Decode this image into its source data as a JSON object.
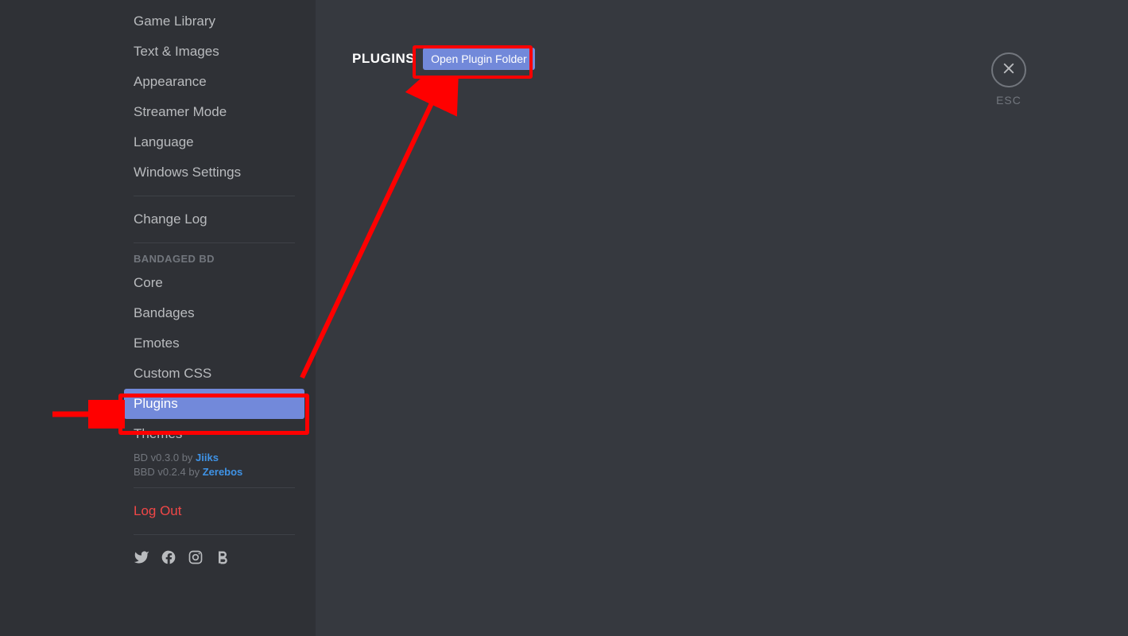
{
  "sidebar": {
    "items_top": [
      "Game Library",
      "Text & Images",
      "Appearance",
      "Streamer Mode",
      "Language",
      "Windows Settings"
    ],
    "change_log": "Change Log",
    "bbd_header": "BANDAGED BD",
    "bbd_items": [
      "Core",
      "Bandages",
      "Emotes",
      "Custom CSS",
      "Plugins",
      "Themes"
    ],
    "selected_index": 4,
    "version1_pre": "BD v0.3.0 by ",
    "version1_author": "Jiiks",
    "version2_pre": "BBD v0.2.4 by ",
    "version2_author": "Zerebos",
    "logout": "Log Out"
  },
  "content": {
    "title": "PLUGINS",
    "open_folder": "Open Plugin Folder"
  },
  "close": {
    "esc": "ESC"
  }
}
